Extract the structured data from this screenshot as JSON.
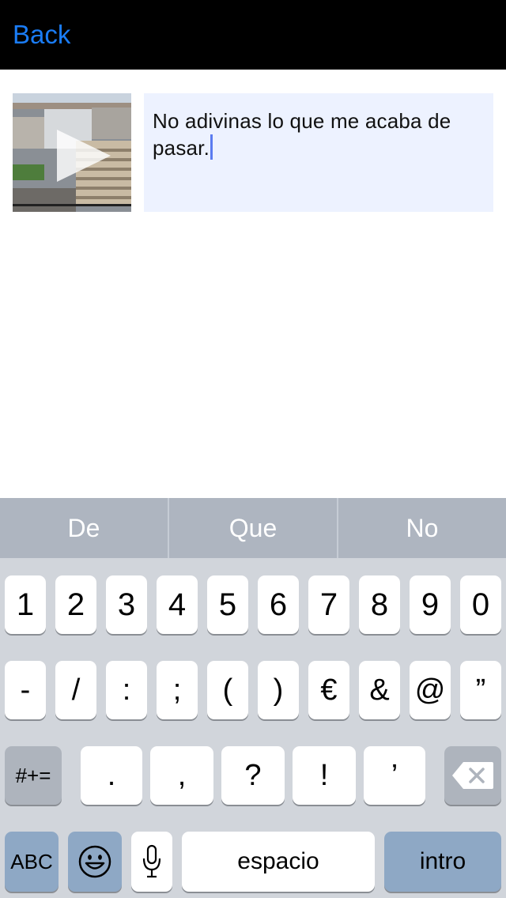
{
  "header": {
    "back_label": "Back",
    "back_color": "#1a7cf5",
    "background": "#000000"
  },
  "content": {
    "thumbnail_icon": "play-icon",
    "message_text": "No adivinas lo que me acaba de pasar."
  },
  "keyboard": {
    "suggestions": [
      "De",
      "Que",
      "No"
    ],
    "row1": [
      "1",
      "2",
      "3",
      "4",
      "5",
      "6",
      "7",
      "8",
      "9",
      "0"
    ],
    "row2": [
      "-",
      "/",
      ":",
      ";",
      "(",
      ")",
      "€",
      "&",
      "@",
      "”"
    ],
    "row3_toggle": "#+=",
    "row3": [
      ".",
      ",",
      "?",
      "!",
      "’"
    ],
    "backspace_icon": "backspace-icon",
    "abc_label": "ABC",
    "emoji_icon": "emoji-icon",
    "mic_icon": "microphone-icon",
    "space_label": "espacio",
    "return_label": "intro"
  }
}
